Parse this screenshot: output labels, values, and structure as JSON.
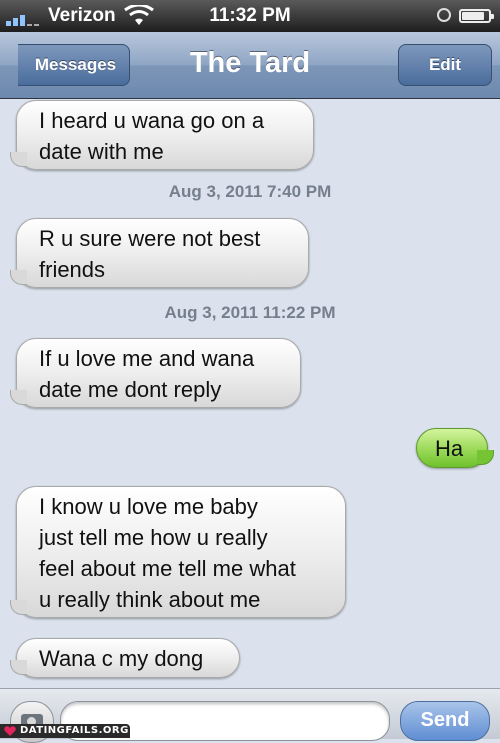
{
  "status_bar": {
    "carrier": "Verizon",
    "time": "11:32 PM",
    "icons": [
      "signal-bars-icon",
      "wifi-icon",
      "alarm-icon",
      "battery-icon"
    ]
  },
  "nav": {
    "back_label": "Messages",
    "title": "The Tard",
    "edit_label": "Edit"
  },
  "messages": [
    {
      "type": "incoming",
      "lines": [
        "I heard u wana go on a",
        "date with me"
      ]
    },
    {
      "type": "timestamp",
      "text": "Aug 3, 2011 7:40 PM"
    },
    {
      "type": "incoming",
      "lines": [
        "R u sure were not best",
        "friends"
      ]
    },
    {
      "type": "timestamp",
      "text": "Aug 3, 2011 11:22 PM"
    },
    {
      "type": "incoming",
      "lines": [
        "If u love me and wana",
        "date me dont reply"
      ]
    },
    {
      "type": "outgoing",
      "lines": [
        "Ha"
      ]
    },
    {
      "type": "incoming",
      "lines": [
        "I know u love me baby",
        "just tell me how u really",
        "feel about me tell me what",
        "u really think about me"
      ]
    },
    {
      "type": "incoming",
      "lines": [
        "Wana c my dong"
      ]
    }
  ],
  "input": {
    "send_label": "Send"
  },
  "watermark": "DATINGFAILS.ORG",
  "colors": {
    "outgoing_bubble": "#9fdb5c",
    "incoming_bubble": "#eeeeee",
    "nav_bar": "#8ea5c4",
    "background": "#dbe2ed"
  }
}
